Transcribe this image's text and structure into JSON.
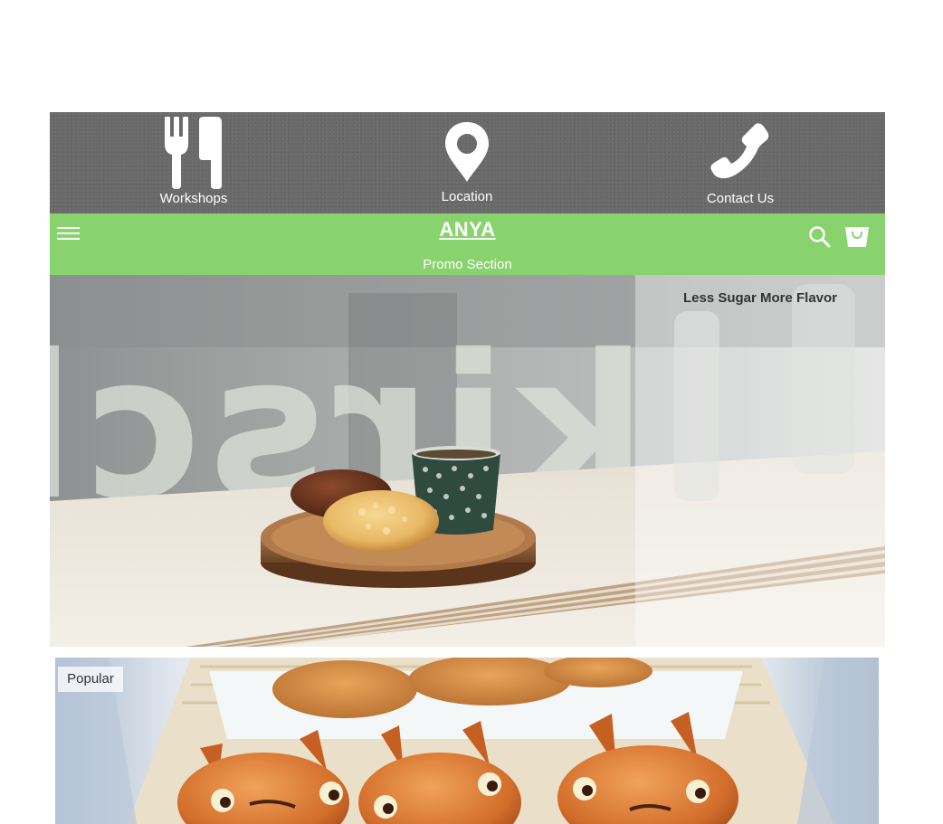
{
  "info_bar": {
    "items": [
      {
        "label": "Workshops",
        "icon": "utensils-icon"
      },
      {
        "label": "Location",
        "icon": "map-pin-icon"
      },
      {
        "label": "Contact Us",
        "icon": "phone-icon"
      }
    ]
  },
  "header": {
    "brand": "ANYA",
    "promo_label": "Promo Section",
    "menu_icon": "hamburger-menu-icon",
    "search_icon": "search-icon",
    "bag_icon": "shopping-bag-icon"
  },
  "hero": {
    "caption": "Less Sugar More Flavor",
    "window_lettering": "kirsche"
  },
  "popular": {
    "badge": "Popular"
  },
  "colors": {
    "header_green": "#89d36f",
    "info_bar_gray": "#6a6a6a",
    "white": "#ffffff"
  }
}
